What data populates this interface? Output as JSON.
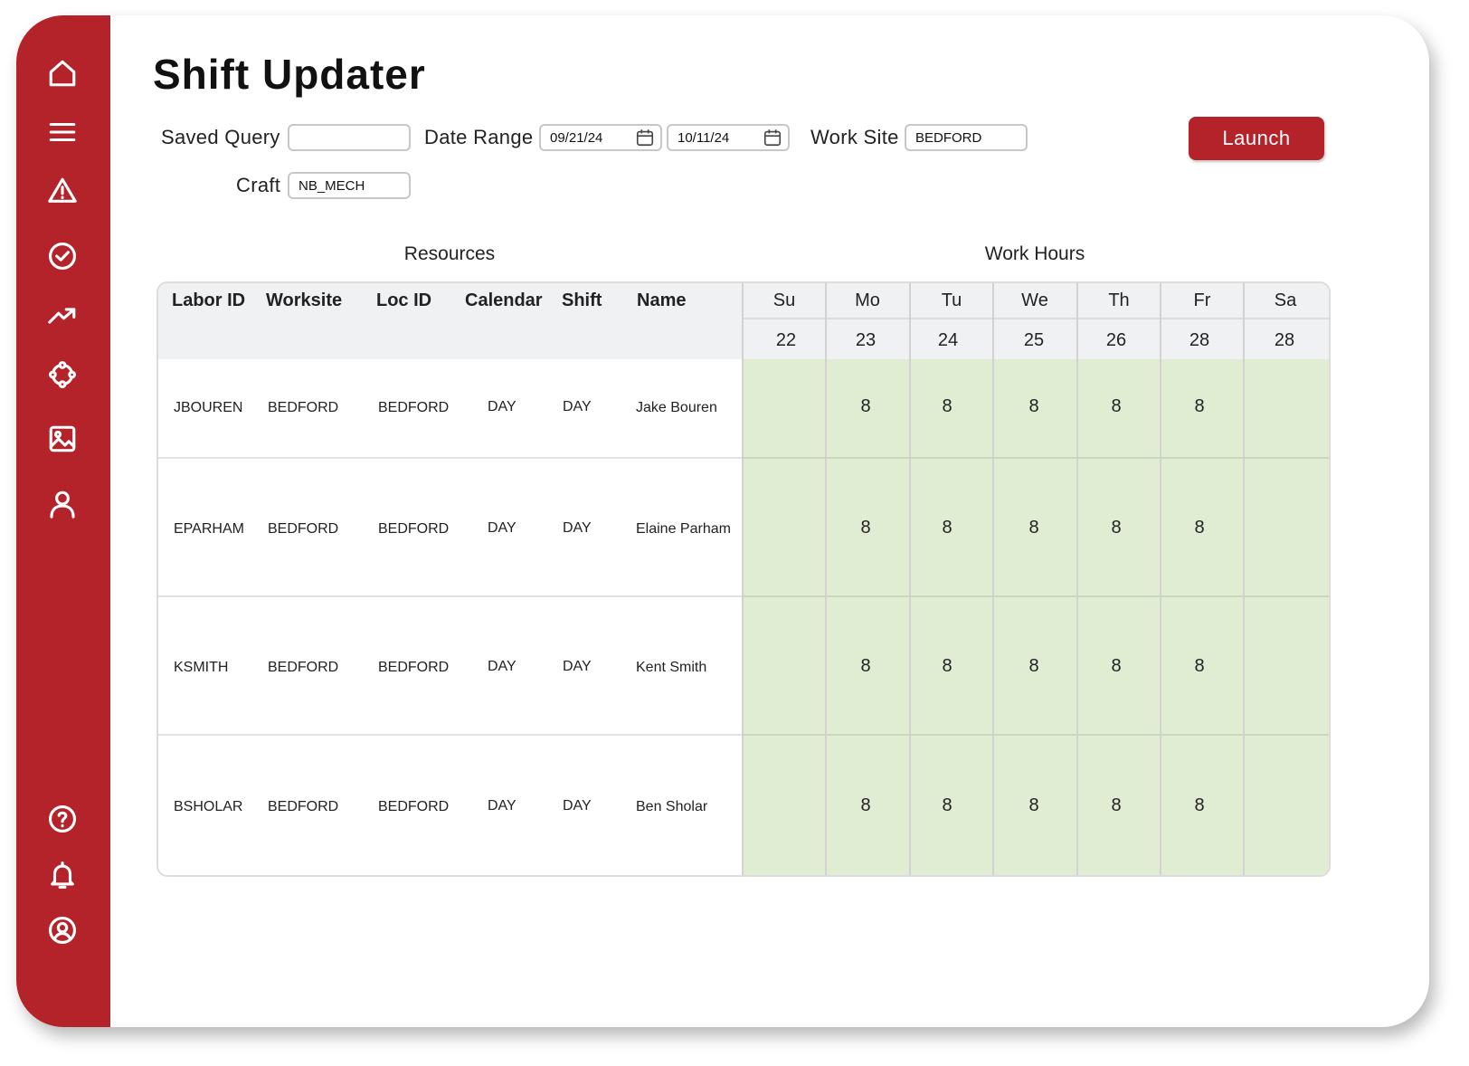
{
  "colors": {
    "brand": "#b4232a",
    "hours_bg": "#e1edd3",
    "header_bg": "#f0f1f2"
  },
  "sidebar": {
    "top_icons": [
      "home-icon",
      "menu-icon",
      "alert-triangle-icon",
      "check-circle-icon",
      "trend-icon",
      "network-icon",
      "image-icon",
      "user-icon"
    ],
    "bottom_icons": [
      "help-icon",
      "bell-icon",
      "account-icon"
    ]
  },
  "page": {
    "title": "Shift Updater"
  },
  "filters": {
    "saved_query": {
      "label": "Saved Query",
      "value": ""
    },
    "date_range": {
      "label": "Date Range",
      "start": "09/21/24",
      "end": "10/11/24"
    },
    "work_site": {
      "label": "Work Site",
      "value": "BEDFORD"
    },
    "craft": {
      "label": "Craft",
      "value": "NB_MECH"
    },
    "launch_label": "Launch"
  },
  "table": {
    "resources_label": "Resources",
    "work_hours_label": "Work Hours",
    "columns": [
      "Labor ID",
      "Worksite",
      "Loc ID",
      "Calendar",
      "Shift",
      "Name"
    ],
    "days": [
      {
        "day": "Su",
        "date": "22"
      },
      {
        "day": "Mo",
        "date": "23"
      },
      {
        "day": "Tu",
        "date": "24"
      },
      {
        "day": "We",
        "date": "25"
      },
      {
        "day": "Th",
        "date": "26"
      },
      {
        "day": "Fr",
        "date": "28"
      },
      {
        "day": "Sa",
        "date": "28"
      }
    ],
    "rows": [
      {
        "labor_id": "JBOUREN",
        "worksite": "BEDFORD",
        "loc_id": "BEDFORD",
        "calendar": "DAY",
        "shift": "DAY",
        "name": "Jake Bouren",
        "hours": [
          "",
          "8",
          "8",
          "8",
          "8",
          "8",
          ""
        ]
      },
      {
        "labor_id": "EPARHAM",
        "worksite": "BEDFORD",
        "loc_id": "BEDFORD",
        "calendar": "DAY",
        "shift": "DAY",
        "name": "Elaine Parham",
        "hours": [
          "",
          "8",
          "8",
          "8",
          "8",
          "8",
          ""
        ]
      },
      {
        "labor_id": "KSMITH",
        "worksite": "BEDFORD",
        "loc_id": "BEDFORD",
        "calendar": "DAY",
        "shift": "DAY",
        "name": "Kent Smith",
        "hours": [
          "",
          "8",
          "8",
          "8",
          "8",
          "8",
          ""
        ]
      },
      {
        "labor_id": "BSHOLAR",
        "worksite": "BEDFORD",
        "loc_id": "BEDFORD",
        "calendar": "DAY",
        "shift": "DAY",
        "name": "Ben Sholar",
        "hours": [
          "",
          "8",
          "8",
          "8",
          "8",
          "8",
          ""
        ]
      }
    ]
  }
}
